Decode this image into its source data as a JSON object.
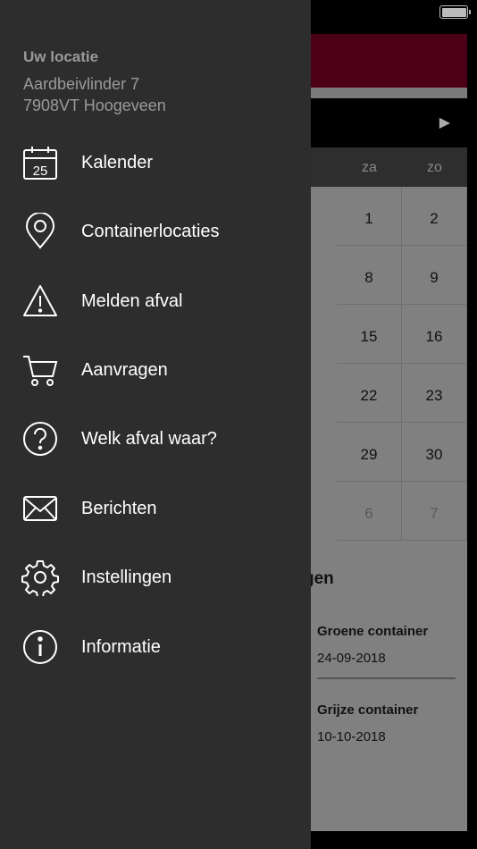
{
  "drawer": {
    "location_title": "Uw locatie",
    "address_line1": "Aardbeivlinder 7",
    "address_line2": "7908VT Hoogeveen",
    "calendar_icon_day": "25",
    "items": [
      {
        "label": "Kalender",
        "icon": "calendar-icon"
      },
      {
        "label": "Containerlocaties",
        "icon": "map-pin-icon"
      },
      {
        "label": "Melden afval",
        "icon": "warning-icon"
      },
      {
        "label": "Aanvragen",
        "icon": "cart-icon"
      },
      {
        "label": "Welk afval waar?",
        "icon": "question-icon"
      },
      {
        "label": "Berichten",
        "icon": "envelope-icon"
      },
      {
        "label": "Instellingen",
        "icon": "gear-icon"
      },
      {
        "label": "Informatie",
        "icon": "info-icon"
      }
    ]
  },
  "background": {
    "next_arrow": "▶",
    "day_headers": [
      "za",
      "zo"
    ],
    "weeks": [
      [
        "1",
        "2"
      ],
      [
        "8",
        "9"
      ],
      [
        "15",
        "16"
      ],
      [
        "22",
        "23"
      ],
      [
        "29",
        "30"
      ],
      [
        "6",
        "7"
      ]
    ],
    "section_title_fragment": "gen",
    "pickups": [
      {
        "name": "Groene container",
        "date": "24-09-2018"
      },
      {
        "name": "Grijze container",
        "date": "10-10-2018"
      }
    ]
  },
  "colors": {
    "drawer_bg": "#2d2d2d",
    "banner": "#4c0015",
    "text_primary": "#ffffff",
    "text_secondary": "#9a9a9a"
  }
}
